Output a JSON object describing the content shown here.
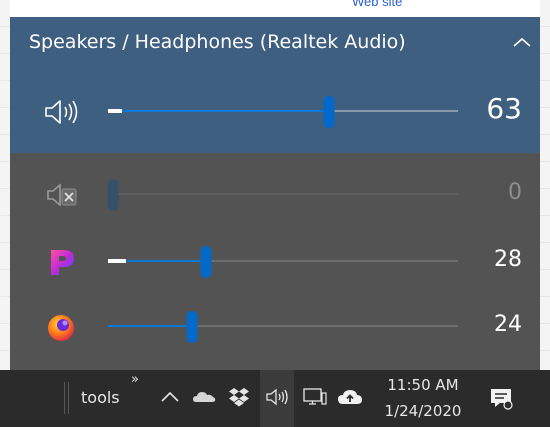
{
  "background": {
    "link_text": "Web site"
  },
  "flyout": {
    "device_name": "Speakers / Headphones (Realtek Audio)",
    "collapse_icon": "chevron-up-icon",
    "master": {
      "icon": "speaker-icon",
      "level": 63,
      "peak": 4,
      "value": "63"
    },
    "apps": [
      {
        "name": "system-sounds",
        "icon": "speaker-muted-icon",
        "level": 0,
        "peak": 0,
        "value": "0",
        "muted": true
      },
      {
        "name": "app-p",
        "icon": "app-p-icon",
        "level": 28,
        "peak": 5,
        "value": "28",
        "muted": false
      },
      {
        "name": "firefox",
        "icon": "firefox-icon",
        "level": 24,
        "peak": 0,
        "value": "24",
        "muted": false
      }
    ]
  },
  "taskbar": {
    "toolbar_label": "tools",
    "toolbar_chevron": "»",
    "tray_icons": [
      "chevron-up-icon",
      "onedrive-icon",
      "dropbox-icon",
      "volume-icon",
      "network-icon",
      "upload-icon"
    ],
    "time": "11:50 AM",
    "date": "1/24/2020",
    "notification_icon": "action-center-icon"
  },
  "colors": {
    "header_bg": "#3e5f80",
    "panel_bg": "#535353",
    "accent": "#0a78d7",
    "taskbar_bg": "#2b2b2b"
  }
}
